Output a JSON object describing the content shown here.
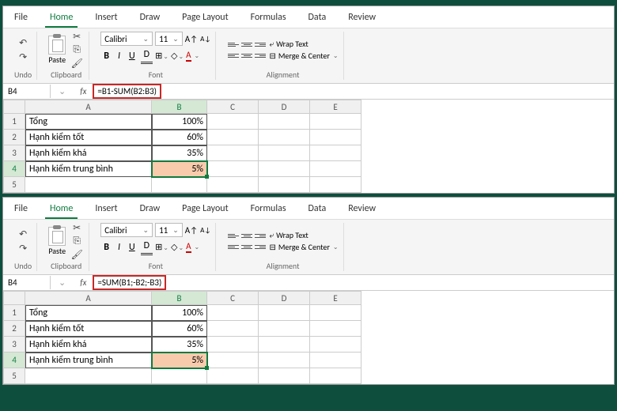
{
  "instances": [
    {
      "tabs": [
        "File",
        "Home",
        "Insert",
        "Draw",
        "Page Layout",
        "Formulas",
        "Data",
        "Review"
      ],
      "active_tab": "Home",
      "groups": {
        "undo": "Undo",
        "clipboard": "Clipboard",
        "paste": "Paste",
        "font": "Font",
        "alignment": "Alignment"
      },
      "font": {
        "name": "Calibri",
        "size": "11"
      },
      "wrap_text": "Wrap Text",
      "merge_center": "Merge & Center",
      "name_box": "B4",
      "fx": "fx",
      "formula": "=B1-SUM(B2:B3)",
      "columns": [
        "A",
        "B",
        "C",
        "D",
        "E"
      ],
      "rows": [
        {
          "n": "1",
          "a": "Tổng",
          "b": "100%"
        },
        {
          "n": "2",
          "a": "Hạnh kiểm tốt",
          "b": "60%"
        },
        {
          "n": "3",
          "a": "Hạnh kiểm khá",
          "b": "35%"
        },
        {
          "n": "4",
          "a": "Hạnh kiểm trung bình",
          "b": "5%",
          "selected": true
        },
        {
          "n": "5",
          "a": "",
          "b": ""
        }
      ]
    },
    {
      "tabs": [
        "File",
        "Home",
        "Insert",
        "Draw",
        "Page Layout",
        "Formulas",
        "Data",
        "Review"
      ],
      "active_tab": "Home",
      "groups": {
        "undo": "Undo",
        "clipboard": "Clipboard",
        "paste": "Paste",
        "font": "Font",
        "alignment": "Alignment"
      },
      "font": {
        "name": "Calibri",
        "size": "11"
      },
      "wrap_text": "Wrap Text",
      "merge_center": "Merge & Center",
      "name_box": "B4",
      "fx": "fx",
      "formula": "=SUM(B1;-B2;-B3)",
      "columns": [
        "A",
        "B",
        "C",
        "D",
        "E"
      ],
      "rows": [
        {
          "n": "1",
          "a": "Tổng",
          "b": "100%"
        },
        {
          "n": "2",
          "a": "Hạnh kiểm tốt",
          "b": "60%"
        },
        {
          "n": "3",
          "a": "Hạnh kiểm khá",
          "b": "35%"
        },
        {
          "n": "4",
          "a": "Hạnh kiểm trung bình",
          "b": "5%",
          "selected": true
        },
        {
          "n": "5",
          "a": "",
          "b": ""
        }
      ]
    }
  ]
}
